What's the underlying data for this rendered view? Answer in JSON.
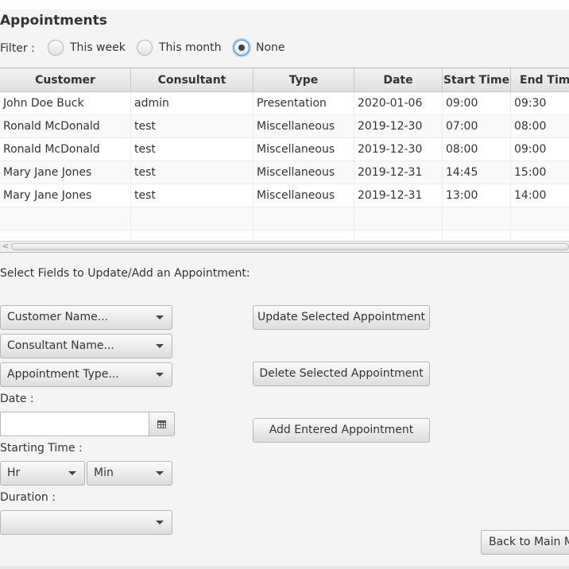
{
  "title": "Appointments",
  "filter": {
    "label": "Filter :",
    "options": [
      {
        "label": "This week",
        "selected": false
      },
      {
        "label": "This month",
        "selected": false
      },
      {
        "label": "None",
        "selected": true
      }
    ]
  },
  "table": {
    "columns": [
      "Customer",
      "Consultant",
      "Type",
      "Date",
      "Start Time",
      "End Time"
    ],
    "rows": [
      [
        "John Doe Buck",
        "admin",
        "Presentation",
        "2020-01-06",
        "09:00",
        "09:30"
      ],
      [
        "Ronald McDonald",
        "test",
        "Miscellaneous",
        "2019-12-30",
        "07:00",
        "08:00"
      ],
      [
        "Ronald McDonald",
        "test",
        "Miscellaneous",
        "2019-12-30",
        "08:00",
        "09:00"
      ],
      [
        "Mary Jane Jones",
        "test",
        "Miscellaneous",
        "2019-12-31",
        "14:45",
        "15:00"
      ],
      [
        "Mary Jane Jones",
        "test",
        "Miscellaneous",
        "2019-12-31",
        "13:00",
        "14:00"
      ]
    ],
    "scroll_left_glyph": "<"
  },
  "form": {
    "heading": "Select Fields to Update/Add an Appointment:",
    "customer_prompt": "Customer Name...",
    "consultant_prompt": "Consultant Name...",
    "type_prompt": "Appointment Type...",
    "date_label": "Date :",
    "date_value": "",
    "start_time_label": "Starting Time :",
    "hour_prompt": "Hr",
    "minute_prompt": "Min",
    "duration_label": "Duration :",
    "duration_value": ""
  },
  "buttons": {
    "update": "Update Selected Appointment",
    "delete": "Delete Selected Appointment",
    "add": "Add Entered Appointment",
    "back": "Back to Main Menu"
  }
}
